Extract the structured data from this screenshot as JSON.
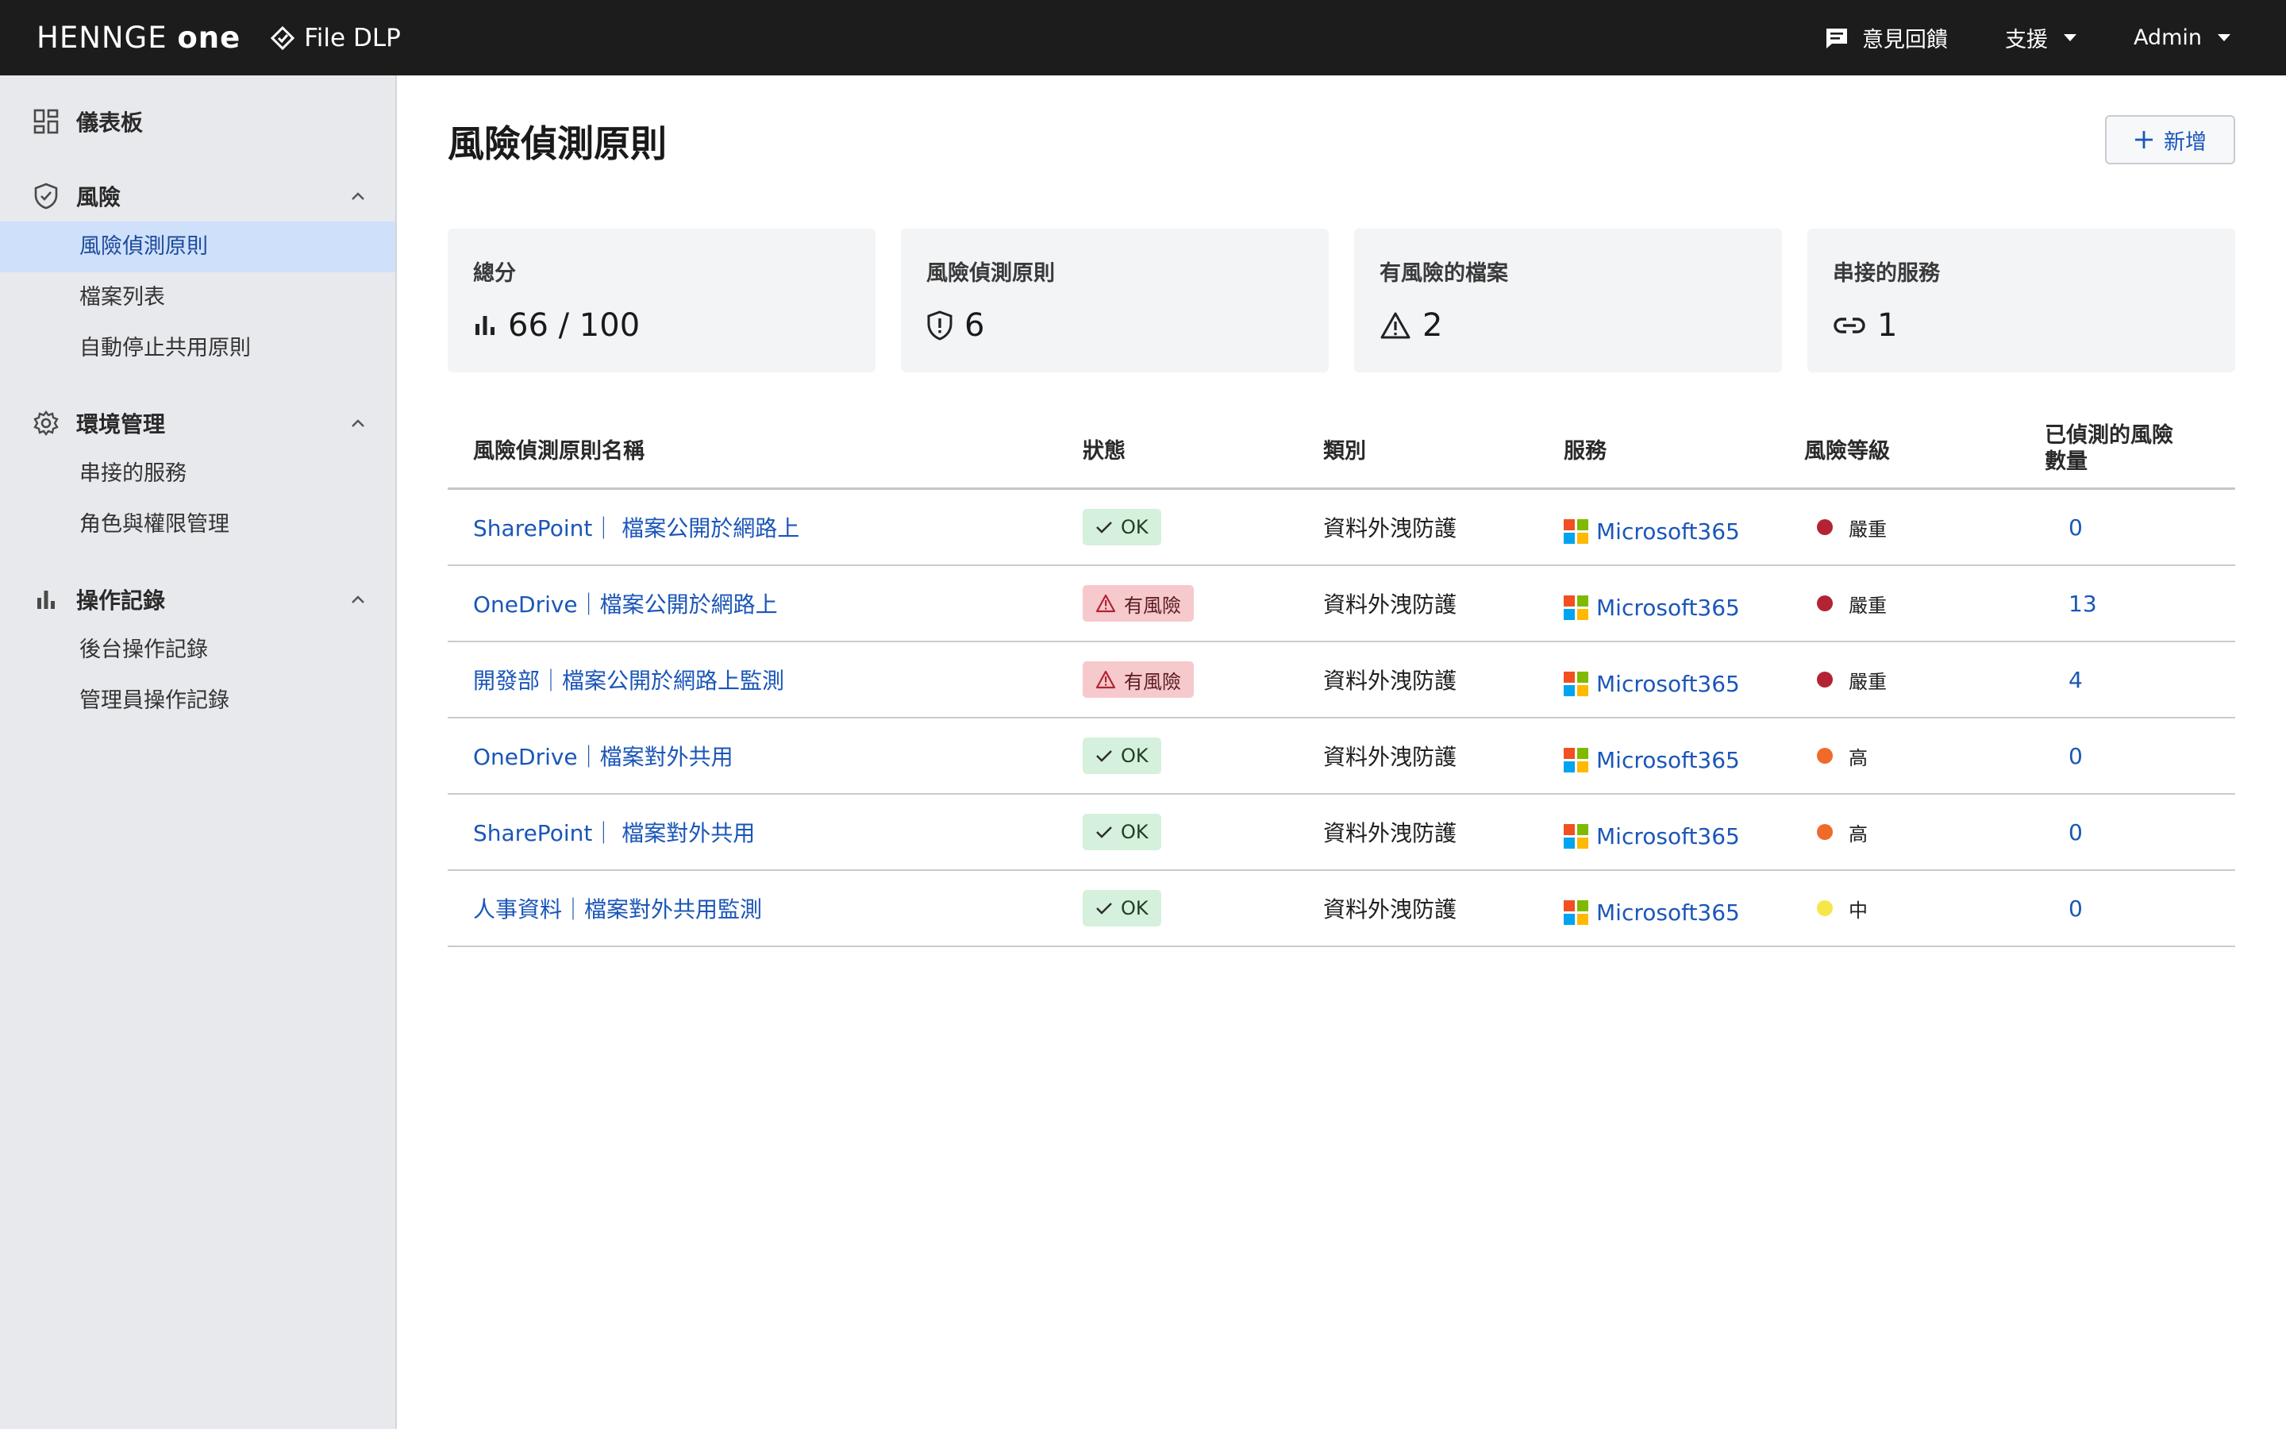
{
  "topbar": {
    "brand_left": "HENNGE ",
    "brand_right": "one",
    "product": "File DLP",
    "feedback": "意見回饋",
    "support": "支援",
    "user": "Admin"
  },
  "sidebar": {
    "dashboard": "儀表板",
    "groups": [
      {
        "label": "風險",
        "items": [
          "風險偵測原則",
          "檔案列表",
          "自動停止共用原則"
        ]
      },
      {
        "label": "環境管理",
        "items": [
          "串接的服務",
          "角色與權限管理"
        ]
      },
      {
        "label": "操作記錄",
        "items": [
          "後台操作記錄",
          "管理員操作記錄"
        ]
      }
    ]
  },
  "main": {
    "title": "風險偵測原則",
    "add_label": "新增",
    "stats": [
      {
        "label": "總分",
        "value": "66 / 100",
        "icon": "bar-chart-icon"
      },
      {
        "label": "風險偵測原則",
        "value": "6",
        "icon": "shield-alert-icon"
      },
      {
        "label": "有風險的檔案",
        "value": "2",
        "icon": "warning-icon"
      },
      {
        "label": "串接的服務",
        "value": "1",
        "icon": "link-icon"
      }
    ],
    "table": {
      "headers": [
        "風險偵測原則名稱",
        "狀態",
        "類別",
        "服務",
        "風險等級",
        "已偵測的風險",
        "數量"
      ],
      "rows": [
        {
          "name": "SharePoint｜ 檔案公開於網路上",
          "status": "OK",
          "status_type": "ok",
          "category": "資料外洩防護",
          "service": "Microsoft365",
          "level": "嚴重",
          "level_color": "#b42334",
          "count": "0"
        },
        {
          "name": "OneDrive｜檔案公開於網路上",
          "status": "有風險",
          "status_type": "risk",
          "category": "資料外洩防護",
          "service": "Microsoft365",
          "level": "嚴重",
          "level_color": "#b42334",
          "count": "13"
        },
        {
          "name": "開發部｜檔案公開於網路上監測",
          "status": "有風險",
          "status_type": "risk",
          "category": "資料外洩防護",
          "service": "Microsoft365",
          "level": "嚴重",
          "level_color": "#b42334",
          "count": "4"
        },
        {
          "name": "OneDrive｜檔案對外共用",
          "status": "OK",
          "status_type": "ok",
          "category": "資料外洩防護",
          "service": "Microsoft365",
          "level": "高",
          "level_color": "#f06a2a",
          "count": "0"
        },
        {
          "name": "SharePoint｜ 檔案對外共用",
          "status": "OK",
          "status_type": "ok",
          "category": "資料外洩防護",
          "service": "Microsoft365",
          "level": "高",
          "level_color": "#f06a2a",
          "count": "0"
        },
        {
          "name": "人事資料｜檔案對外共用監測",
          "status": "OK",
          "status_type": "ok",
          "category": "資料外洩防護",
          "service": "Microsoft365",
          "level": "中",
          "level_color": "#f7e64a",
          "count": "0"
        }
      ]
    }
  },
  "colors": {
    "topbar_bg": "#1c1c1c",
    "sidebar_bg": "#e8e9ec",
    "active_bg": "#cfe0fb",
    "link": "#1b56b8",
    "ok_bg": "#d5f0dc",
    "risk_bg": "#f6c9cc"
  }
}
